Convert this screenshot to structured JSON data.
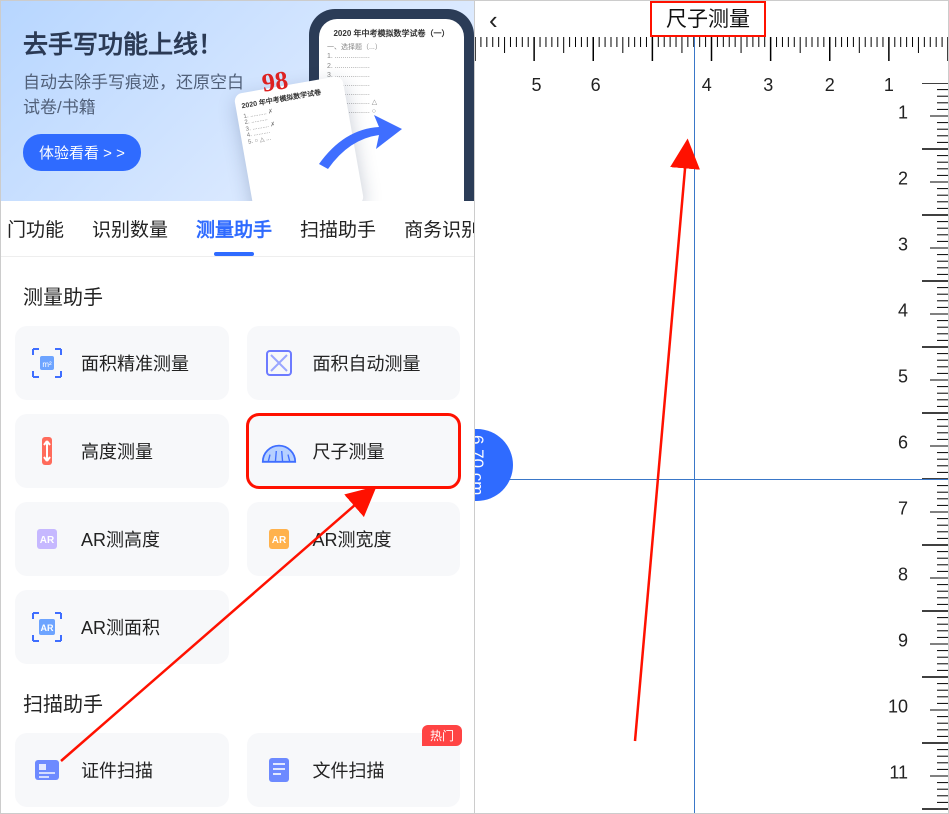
{
  "banner": {
    "title": "去手写功能上线！",
    "subtitle": "自动去除手写痕迹，还原空白试卷/书籍",
    "cta": "体验看看 > >",
    "score": "98"
  },
  "tabs": [
    "门功能",
    "识别数量",
    "测量助手",
    "扫描助手",
    "商务识别"
  ],
  "active_tab_index": 2,
  "sections": [
    {
      "title": "测量助手",
      "items": [
        {
          "label": "面积精准测量",
          "icon": "area-precise-icon"
        },
        {
          "label": "面积自动测量",
          "icon": "area-auto-icon"
        },
        {
          "label": "高度测量",
          "icon": "height-icon"
        },
        {
          "label": "尺子测量",
          "icon": "ruler-icon",
          "highlight": true
        },
        {
          "label": "AR测高度",
          "icon": "ar-height-icon"
        },
        {
          "label": "AR测宽度",
          "icon": "ar-width-icon"
        },
        {
          "label": "AR测面积",
          "icon": "ar-area-icon"
        }
      ]
    },
    {
      "title": "扫描助手",
      "items": [
        {
          "label": "证件扫描",
          "icon": "id-scan-icon"
        },
        {
          "label": "文件扫描",
          "icon": "doc-scan-icon",
          "badge": "热门"
        }
      ]
    }
  ],
  "ruler": {
    "title": "尺子测量",
    "top_numbers": [
      5,
      6,
      4,
      3,
      2,
      1
    ],
    "top_positions_pct": [
      12,
      24.5,
      49,
      62,
      75,
      88
    ],
    "right_numbers": [
      1,
      2,
      3,
      4,
      5,
      6,
      7,
      8,
      9,
      10,
      11
    ],
    "measurement": "6.70 cm"
  },
  "colors": {
    "accent": "#2f6bff",
    "annotation": "#f10"
  }
}
